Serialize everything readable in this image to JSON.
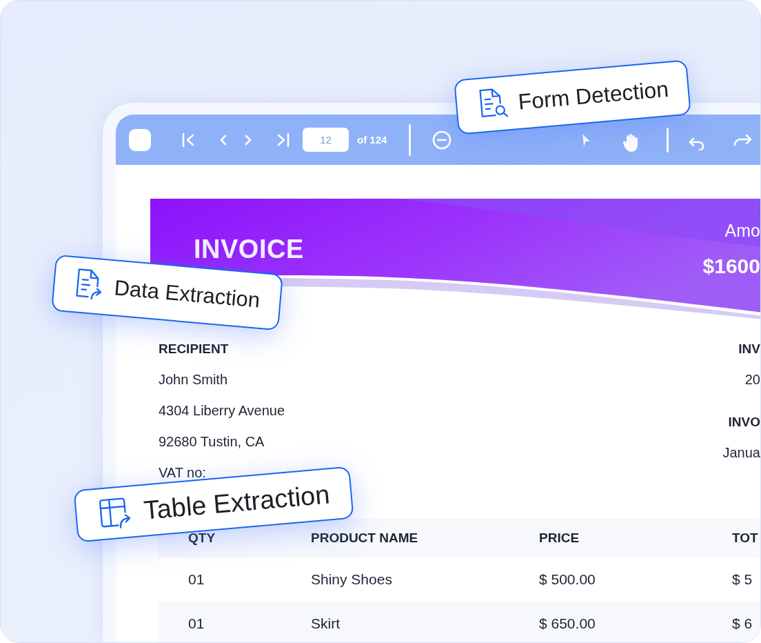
{
  "toolbar": {
    "page_input": {
      "value": "12"
    },
    "page_total": "of 124"
  },
  "invoice": {
    "title": "INVOICE",
    "amount_label": "Amo",
    "amount": "$1600",
    "recipient_heading": "RECIPIENT",
    "recipient_lines": [
      "John Smith",
      "4304 Liberry Avenue",
      "92680 Tustin, CA",
      "VAT no:"
    ],
    "right_column": [
      {
        "kind": "heading",
        "text": "INV"
      },
      {
        "kind": "value",
        "text": "20"
      },
      {
        "kind": "heading",
        "text": "INVO"
      },
      {
        "kind": "value",
        "text": "Janua"
      }
    ],
    "table": {
      "columns": [
        "QTY",
        "PRODUCT NAME",
        "PRICE",
        "TOT"
      ],
      "rows": [
        [
          "01",
          "Shiny Shoes",
          "$ 500.00",
          "$ 5"
        ],
        [
          "01",
          "Skirt",
          "$ 650.00",
          "$ 6"
        ]
      ]
    }
  },
  "feature_badges": [
    {
      "kind": "form",
      "label": "Form Detection"
    },
    {
      "kind": "data",
      "label": "Data Extraction"
    },
    {
      "kind": "table",
      "label": "Table Extraction"
    }
  ]
}
